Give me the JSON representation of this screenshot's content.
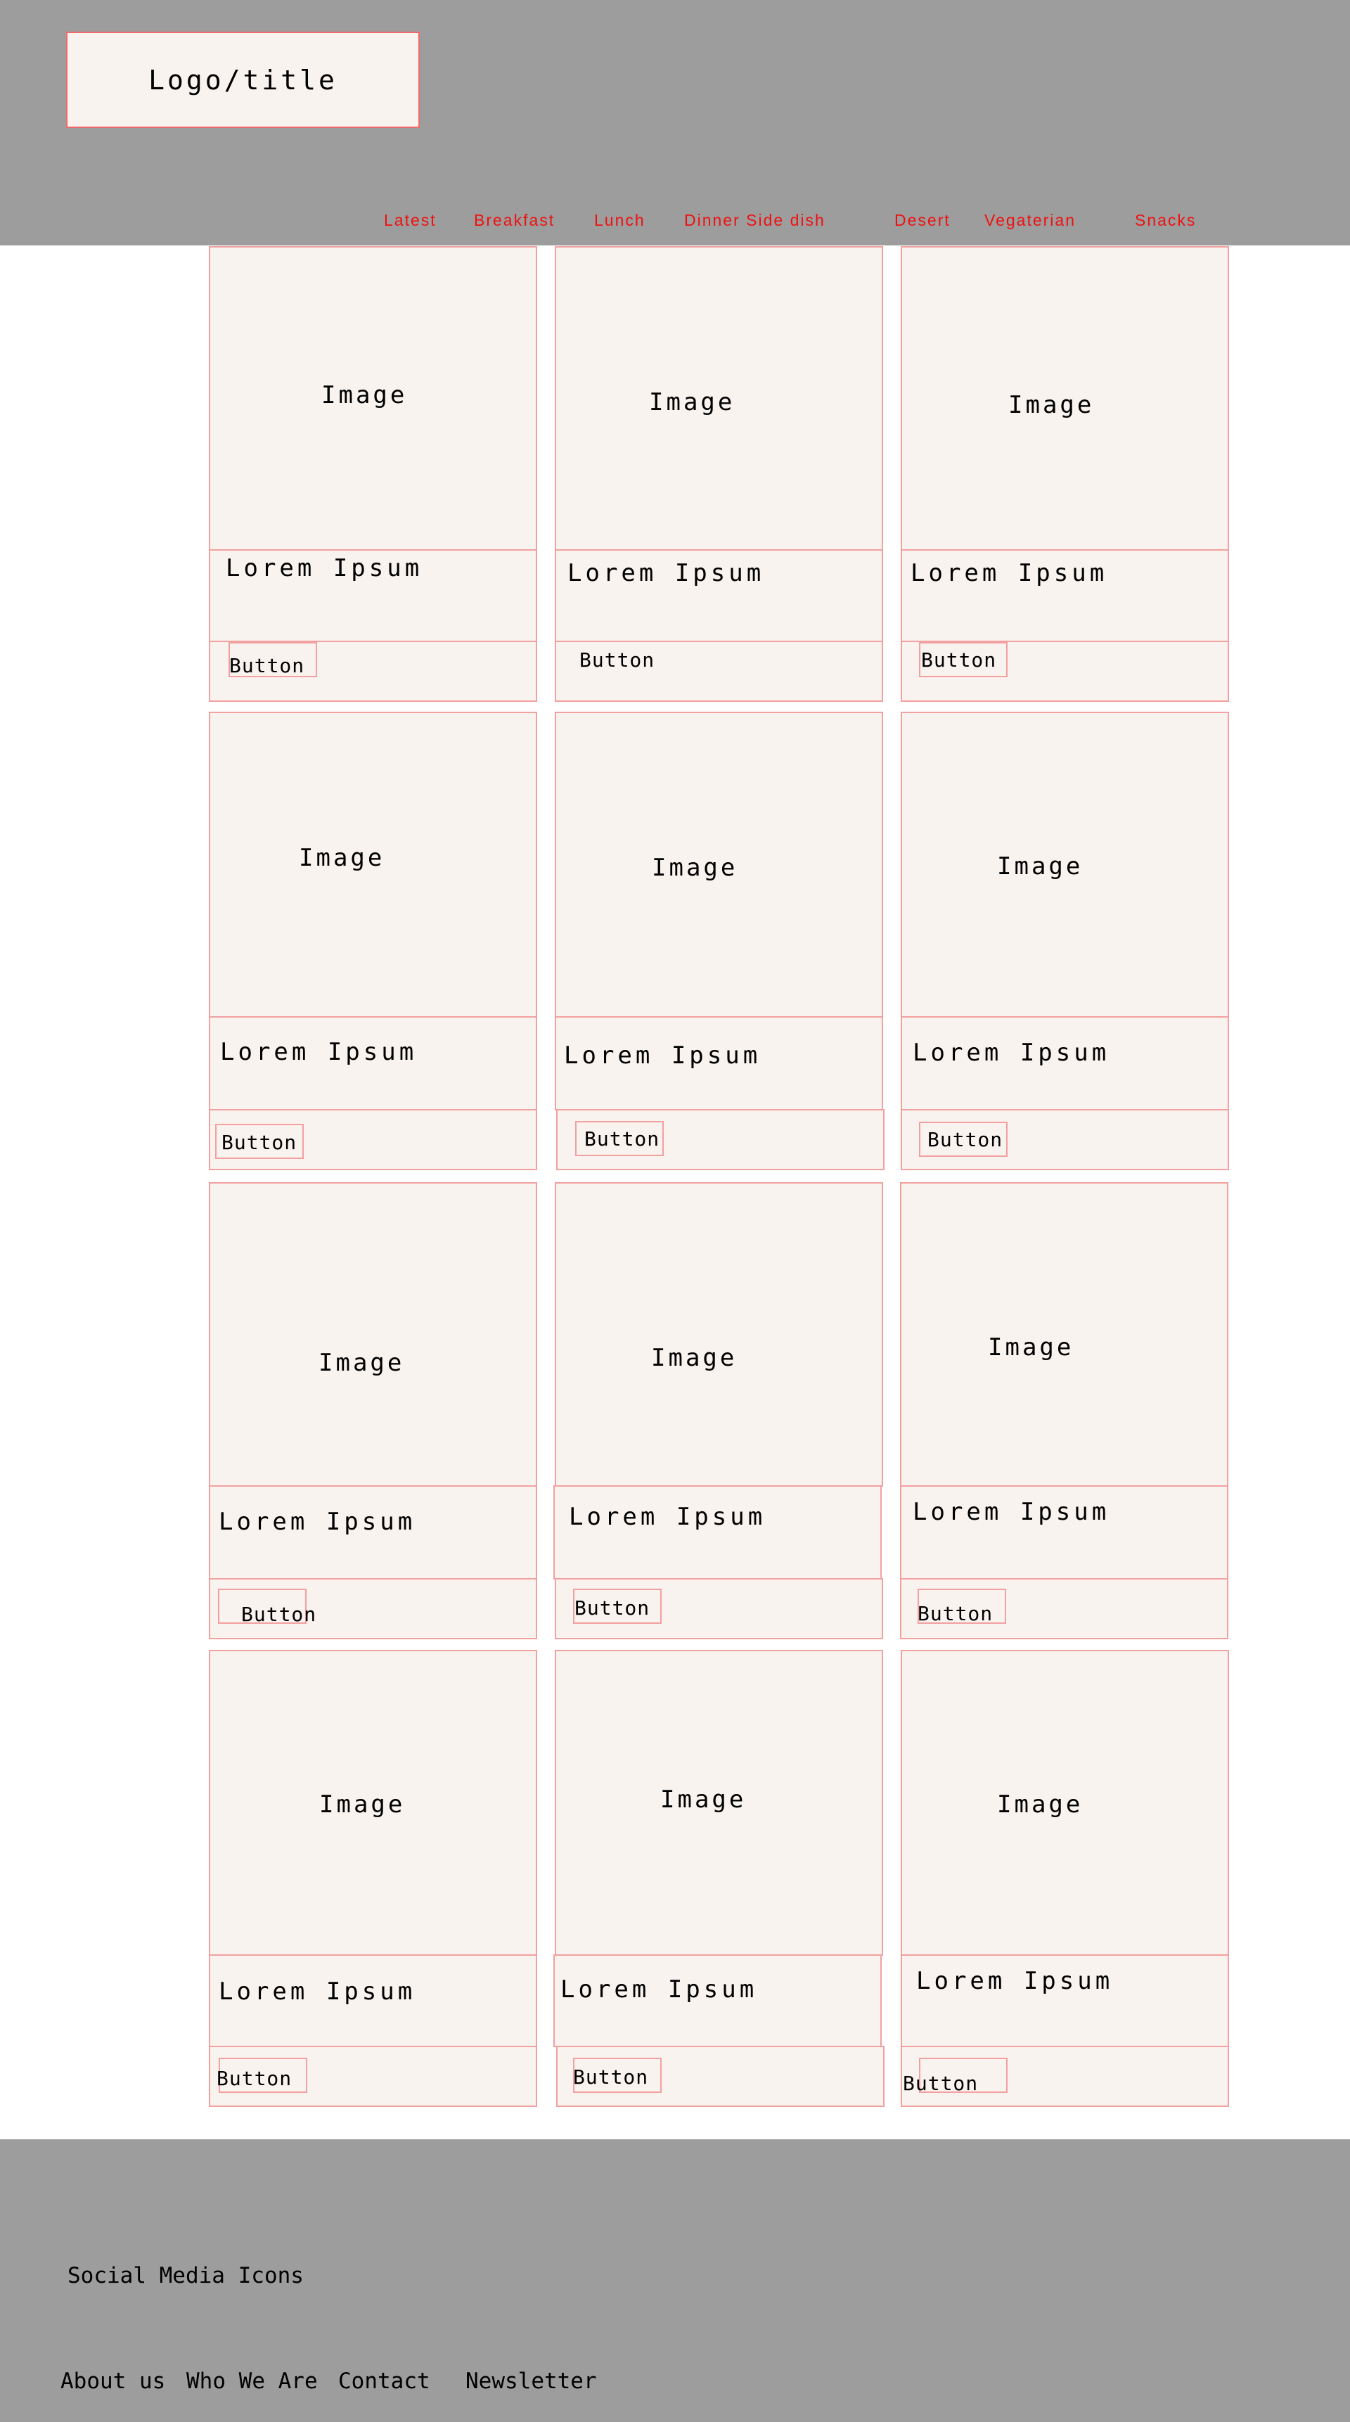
{
  "header": {
    "logo": "Logo/title",
    "nav": [
      "Latest",
      "Breakfast",
      "Lunch",
      "Dinner Side dish",
      "Desert",
      "Vegaterian",
      "Snacks"
    ]
  },
  "cards": [
    {
      "image": "Image",
      "title": "Lorem Ipsum",
      "button": "Button"
    },
    {
      "image": "Image",
      "title": "Lorem Ipsum",
      "button": "Button"
    },
    {
      "image": "Image",
      "title": "Lorem Ipsum",
      "button": "Button"
    },
    {
      "image": "Image",
      "title": "Lorem Ipsum",
      "button": "Button"
    },
    {
      "image": "Image",
      "title": "Lorem Ipsum",
      "button": "Button"
    },
    {
      "image": "Image",
      "title": "Lorem Ipsum",
      "button": "Button"
    },
    {
      "image": "Image",
      "title": "Lorem Ipsum",
      "button": "Button"
    },
    {
      "image": "Image",
      "title": "Lorem Ipsum",
      "button": "Button"
    },
    {
      "image": "Image",
      "title": "Lorem Ipsum",
      "button": "Button"
    },
    {
      "image": "Image",
      "title": "Lorem Ipsum",
      "button": "Button"
    },
    {
      "image": "Image",
      "title": "Lorem Ipsum",
      "button": "Button"
    },
    {
      "image": "Image",
      "title": "Lorem Ipsum",
      "button": "Button"
    }
  ],
  "footer": {
    "social": "Social Media Icons",
    "links": [
      "About us",
      "Who We Are",
      "Contact",
      "Newsletter"
    ]
  },
  "colors": {
    "header_bg": "#9d9d9d",
    "card_bg": "#f9f3ef",
    "border": "#f2a0a0",
    "nav_text": "#ee1111"
  }
}
